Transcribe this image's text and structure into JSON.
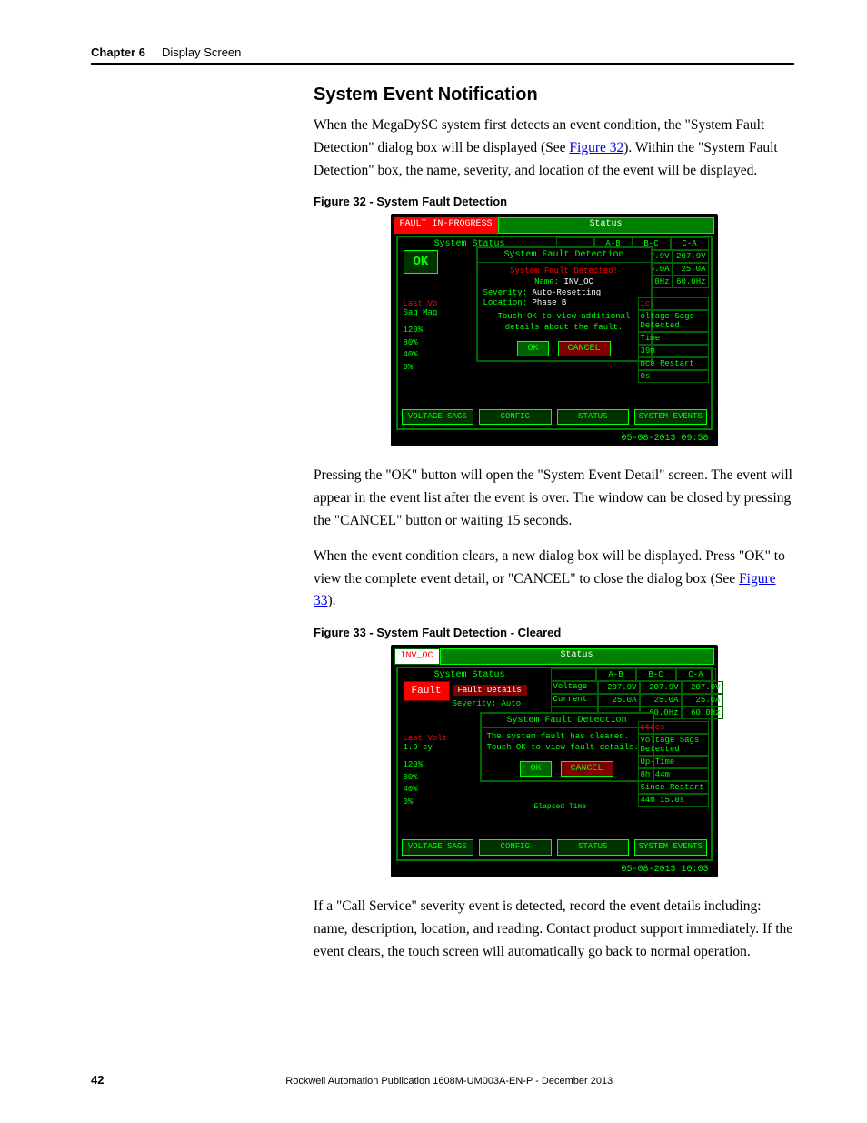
{
  "header": {
    "chapter": "Chapter 6",
    "title": "Display Screen"
  },
  "section_heading": "System Event Notification",
  "para1_a": "When the MegaDySC system first detects an event condition, the \"System Fault Detection\" dialog box will be displayed (See ",
  "para1_link": "Figure 32",
  "para1_b": "). Within the \"System Fault Detection\" box, the name, severity, and location of the event will be displayed.",
  "fig32_caption": "Figure 32 - System Fault Detection",
  "fig32": {
    "fault_banner": "FAULT IN-PROGRESS",
    "status": "Status",
    "sys_status": "System Status",
    "ok": "OK",
    "cols": [
      "A-B",
      "B-C",
      "C-A"
    ],
    "row1": [
      "7.9V",
      "207.9V"
    ],
    "row2": [
      "5.0A",
      "25.0A"
    ],
    "row3": [
      "0Hz",
      "60.0Hz"
    ],
    "dialog_title": "System Fault Detection",
    "dialog_detected": "System Fault Detected!",
    "dialog_name_lbl": "Name:",
    "dialog_name_val": "INV_OC",
    "dialog_sev_lbl": "Severity:",
    "dialog_sev_val": "Auto-Resetting",
    "dialog_loc_lbl": "Location:",
    "dialog_loc_val": "Phase B",
    "dialog_hint": "Touch OK to view additional details about the fault.",
    "ok_btn": "OK",
    "cancel_btn": "CANCEL",
    "side_ics": "ics",
    "side_sags": "oltage Sags Detected",
    "side_time_lbl": "Time",
    "side_time_val": "39m",
    "side_restart_lbl": "nce Restart",
    "side_restart_val": "0s",
    "left_last": "Last Vo",
    "left_sag": "Sag Mag",
    "y120": "120%",
    "y80": "80%",
    "y40": "40%",
    "y0": "0%",
    "nav": [
      "VOLTAGE SAGS",
      "CONFIG",
      "STATUS",
      "SYSTEM EVENTS"
    ],
    "timestamp": "05-08-2013 09:58"
  },
  "para2": "Pressing the \"OK\" button will open the \"System Event Detail\" screen. The event will appear in the event list after the event is over. The window can be closed by pressing the \"CANCEL\" button or waiting 15 seconds.",
  "para3_a": "When the event condition clears, a new dialog box will be displayed. Press \"OK\" to view the complete event detail, or \"CANCEL\" to close the dialog box (See ",
  "para3_link": "Figure 33",
  "para3_b": ").",
  "fig33_caption": "Figure 33 - System Fault Detection - Cleared",
  "fig33": {
    "inv": "INV_OC",
    "status": "Status",
    "sys_status": "System Status",
    "fault": "Fault",
    "fault_details": "Fault Details",
    "sev_line": "Severity: Auto",
    "cols": [
      "A-B",
      "B-C",
      "C-A"
    ],
    "voltage_lbl": "Voltage",
    "current_lbl": "Current",
    "voltage_row": [
      "207.9V",
      "207.9V",
      "207.9V"
    ],
    "current_row": [
      "25.0A",
      "25.0A",
      "25.0A"
    ],
    "hz_row": [
      "60.0Hz",
      "60.0Hz"
    ],
    "dialog_title": "System Fault Detection",
    "dialog_msg": "The system fault has cleared. Touch OK to view fault details.",
    "ok_btn": "OK",
    "cancel_btn": "CANCEL",
    "side_stics": "stics",
    "side_sags": "Voltage Sags Detected",
    "side_uptime_lbl": "Up-Time",
    "side_uptime_val": "8h 44m",
    "side_since_lbl": "Since Restart",
    "side_since_val": "44m 15.0s",
    "elapsed": "Elapsed Time",
    "left_last": "Last Volt",
    "left_cy": "1.9 cy",
    "y120": "120%",
    "y80": "80%",
    "y40": "40%",
    "y0": "0%",
    "nav": [
      "VOLTAGE SAGS",
      "CONFIG",
      "STATUS",
      "SYSTEM EVENTS"
    ],
    "timestamp": "05-08-2013 10:03"
  },
  "para4": "If a \"Call Service\" severity event is detected, record the event details including: name, description, location, and reading. Contact product support immediately. If the event clears, the touch screen will automatically go back to normal operation.",
  "footer": {
    "page": "42",
    "pub": "Rockwell Automation Publication 1608M-UM003A-EN-P - December 2013"
  }
}
